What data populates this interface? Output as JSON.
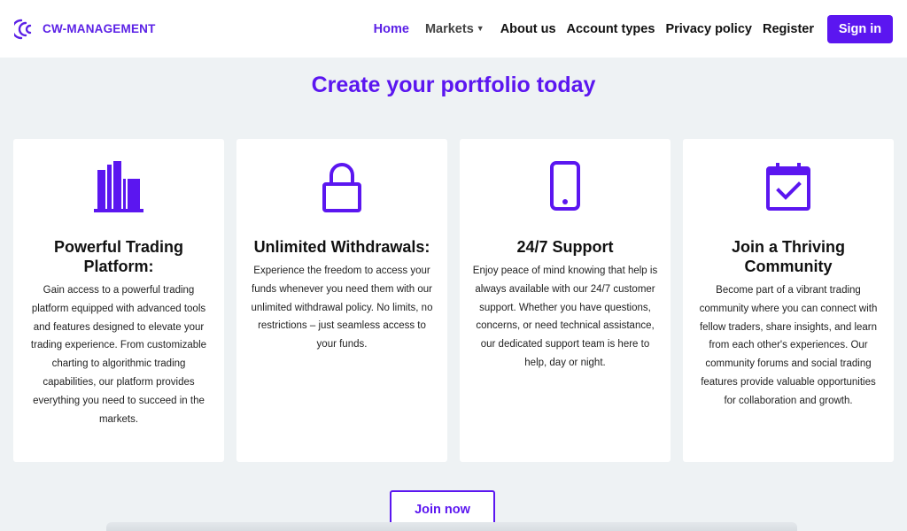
{
  "header": {
    "brand": {
      "name": "CW-MANAGEMENT",
      "logo_icon": "cw-logo-icon"
    },
    "nav": [
      {
        "label": "Home",
        "state": "active"
      },
      {
        "label": "Markets",
        "has_dropdown": true
      },
      {
        "label": "About us"
      },
      {
        "label": "Account types"
      },
      {
        "label": "Privacy policy"
      },
      {
        "label": "Register"
      }
    ],
    "signin_label": "Sign in"
  },
  "main": {
    "headline": "Create your portfolio today",
    "features": [
      {
        "icon": "bar-chart-icon",
        "title": "Powerful Trading Platform:",
        "body": "Gain access to a powerful trading platform equipped with advanced tools and features designed to elevate your trading experience. From customizable charting to algorithmic trading capabilities, our platform provides everything you need to succeed in the markets."
      },
      {
        "icon": "lock-icon",
        "title": "Unlimited Withdrawals:",
        "body": "Experience the freedom to access your funds whenever you need them with our unlimited withdrawal policy. No limits, no restrictions – just seamless access to your funds."
      },
      {
        "icon": "smartphone-icon",
        "title": "24/7 Support",
        "body": "Enjoy peace of mind knowing that help is always available with our 24/7 customer support. Whether you have questions, concerns, or need technical assistance, our dedicated support team is here to help, day or night."
      },
      {
        "icon": "calendar-check-icon",
        "title": "Join a Thriving Community",
        "body": "Become part of a vibrant trading community where you can connect with fellow traders, share insights, and learn from each other's experiences. Our community forums and social trading features provide valuable opportunities for collaboration and growth."
      }
    ],
    "cta_label": "Join now"
  },
  "colors": {
    "accent": "#5b16f0",
    "background": "#eef2f4",
    "card": "#ffffff"
  }
}
